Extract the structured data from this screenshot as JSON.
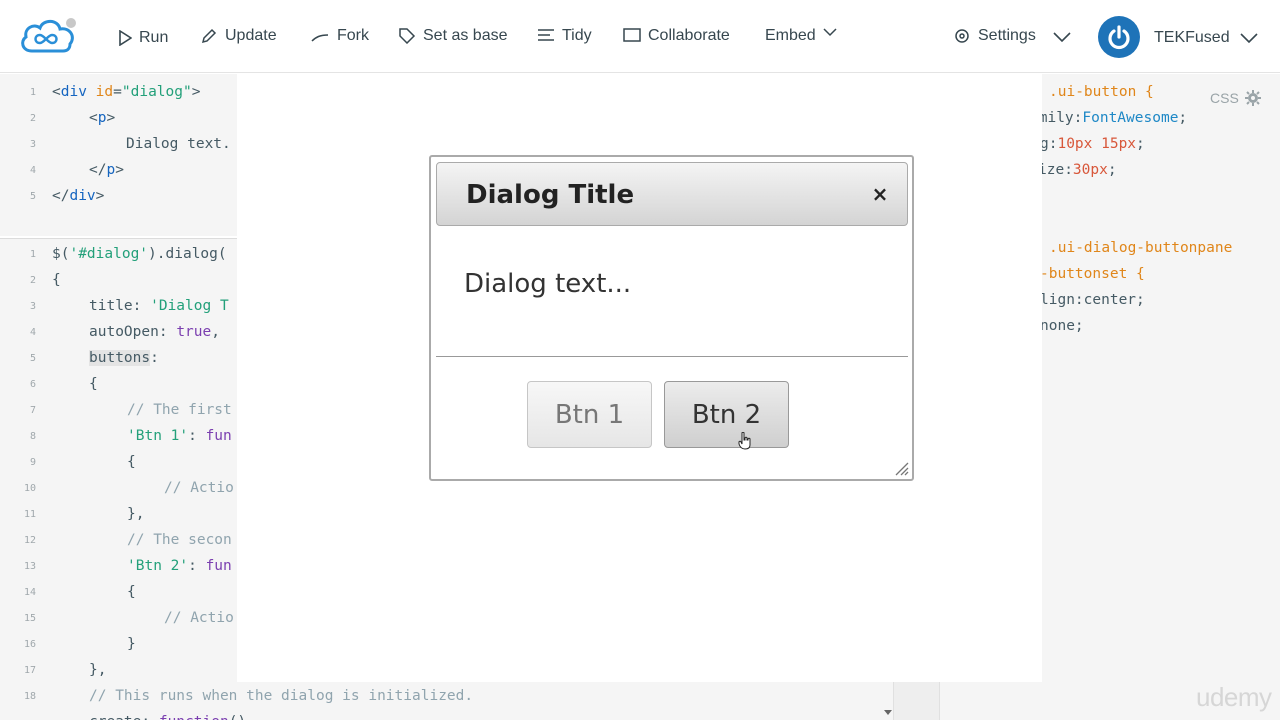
{
  "topbar": {
    "run_label": "Run",
    "update_label": "Update",
    "fork_label": "Fork",
    "set_as_base_label": "Set as base",
    "tidy_label": "Tidy",
    "collaborate_label": "Collaborate",
    "embed_label": "Embed",
    "settings_label": "Settings",
    "username": "TEKFused"
  },
  "html_pane": {
    "lines": [
      {
        "num": "1"
      },
      {
        "num": "2"
      },
      {
        "num": "3",
        "text": "Dialog text."
      },
      {
        "num": "4"
      },
      {
        "num": "5"
      }
    ]
  },
  "js_pane": {
    "line_numbers": [
      "1",
      "2",
      "3",
      "4",
      "5",
      "6",
      "7",
      "8",
      "9",
      "10",
      "11",
      "12",
      "13",
      "14",
      "15",
      "16",
      "17",
      "18"
    ],
    "comment_first": "// The first",
    "comment_action_1": "// Actio",
    "comment_second": "// The secon",
    "comment_action_2": "// Actio",
    "comment_init": "// This runs when the dialog is initialized.",
    "btn1_key": "'Btn 1'",
    "btn2_key": "'Btn 2'",
    "title_str": "'Dialog T"
  },
  "css_pane": {
    "label": "CSS",
    "selector_1": ".ui-button {",
    "selector_2": ".ui-dialog-buttonpane",
    "selector_2b": "-buttonset {",
    "font_val": "FontAwesome",
    "padding_val": "10px 15px",
    "size_val": "30px",
    "align_val": "center",
    "none_val": "none"
  },
  "dialog": {
    "title": "Dialog Title",
    "close_glyph": "×",
    "text": "Dialog text...",
    "btn1_label": "Btn 1",
    "btn2_label": "Btn 2"
  },
  "watermark": "udemy",
  "colors": {
    "avatar": "#1e73b8",
    "logo": "#2a8fd8",
    "code_tag": "#1565c0",
    "code_attr": "#e0861a",
    "code_string": "#23a07a"
  }
}
